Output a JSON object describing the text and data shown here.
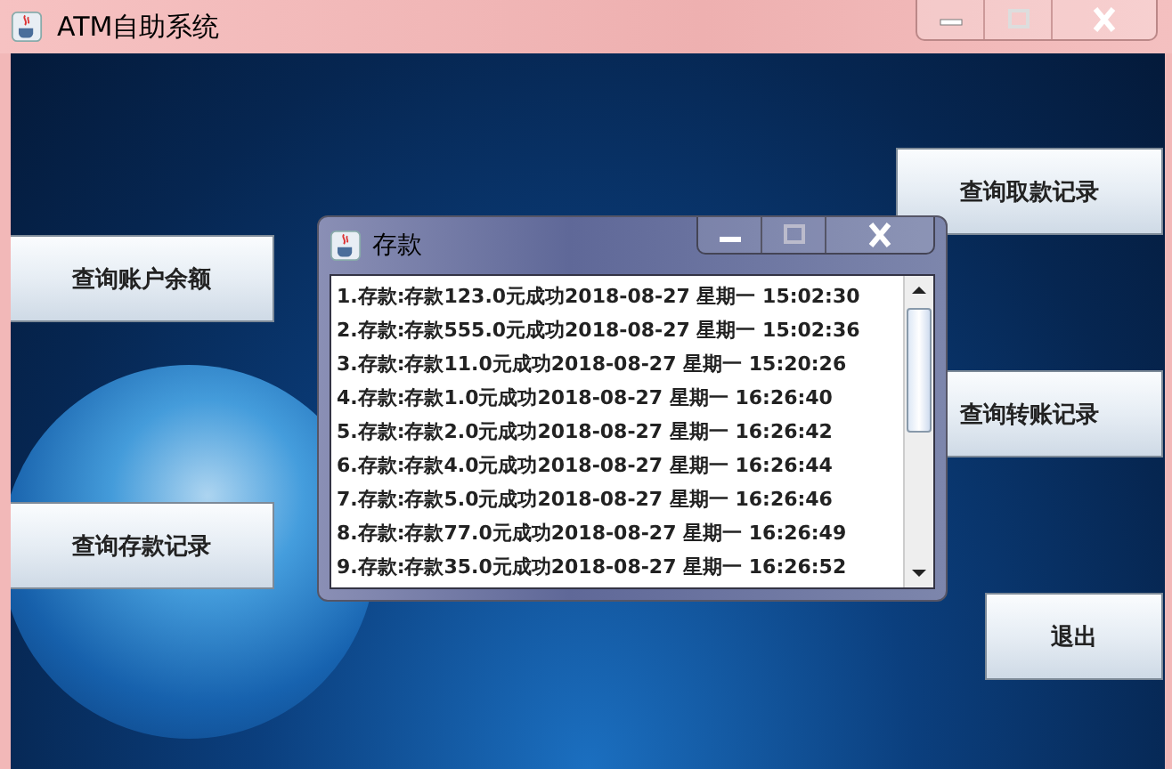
{
  "window": {
    "title": "ATM自助系统"
  },
  "buttons": [
    {
      "label": "查询账户余额"
    },
    {
      "label": "查询存款记录"
    },
    {
      "label": "查询取款记录"
    },
    {
      "label": "查询转账记录"
    },
    {
      "label": "退出"
    }
  ],
  "dialog": {
    "title": "存款",
    "records": [
      "1.存款:存款123.0元成功2018-08-27 星期一 15:02:30",
      "2.存款:存款555.0元成功2018-08-27 星期一 15:02:36",
      "3.存款:存款11.0元成功2018-08-27 星期一 15:20:26",
      "4.存款:存款1.0元成功2018-08-27 星期一 16:26:40",
      "5.存款:存款2.0元成功2018-08-27 星期一 16:26:42",
      "6.存款:存款4.0元成功2018-08-27 星期一 16:26:44",
      "7.存款:存款5.0元成功2018-08-27 星期一 16:26:46",
      "8.存款:存款77.0元成功2018-08-27 星期一 16:26:49",
      "9.存款:存款35.0元成功2018-08-27 星期一 16:26:52"
    ]
  }
}
